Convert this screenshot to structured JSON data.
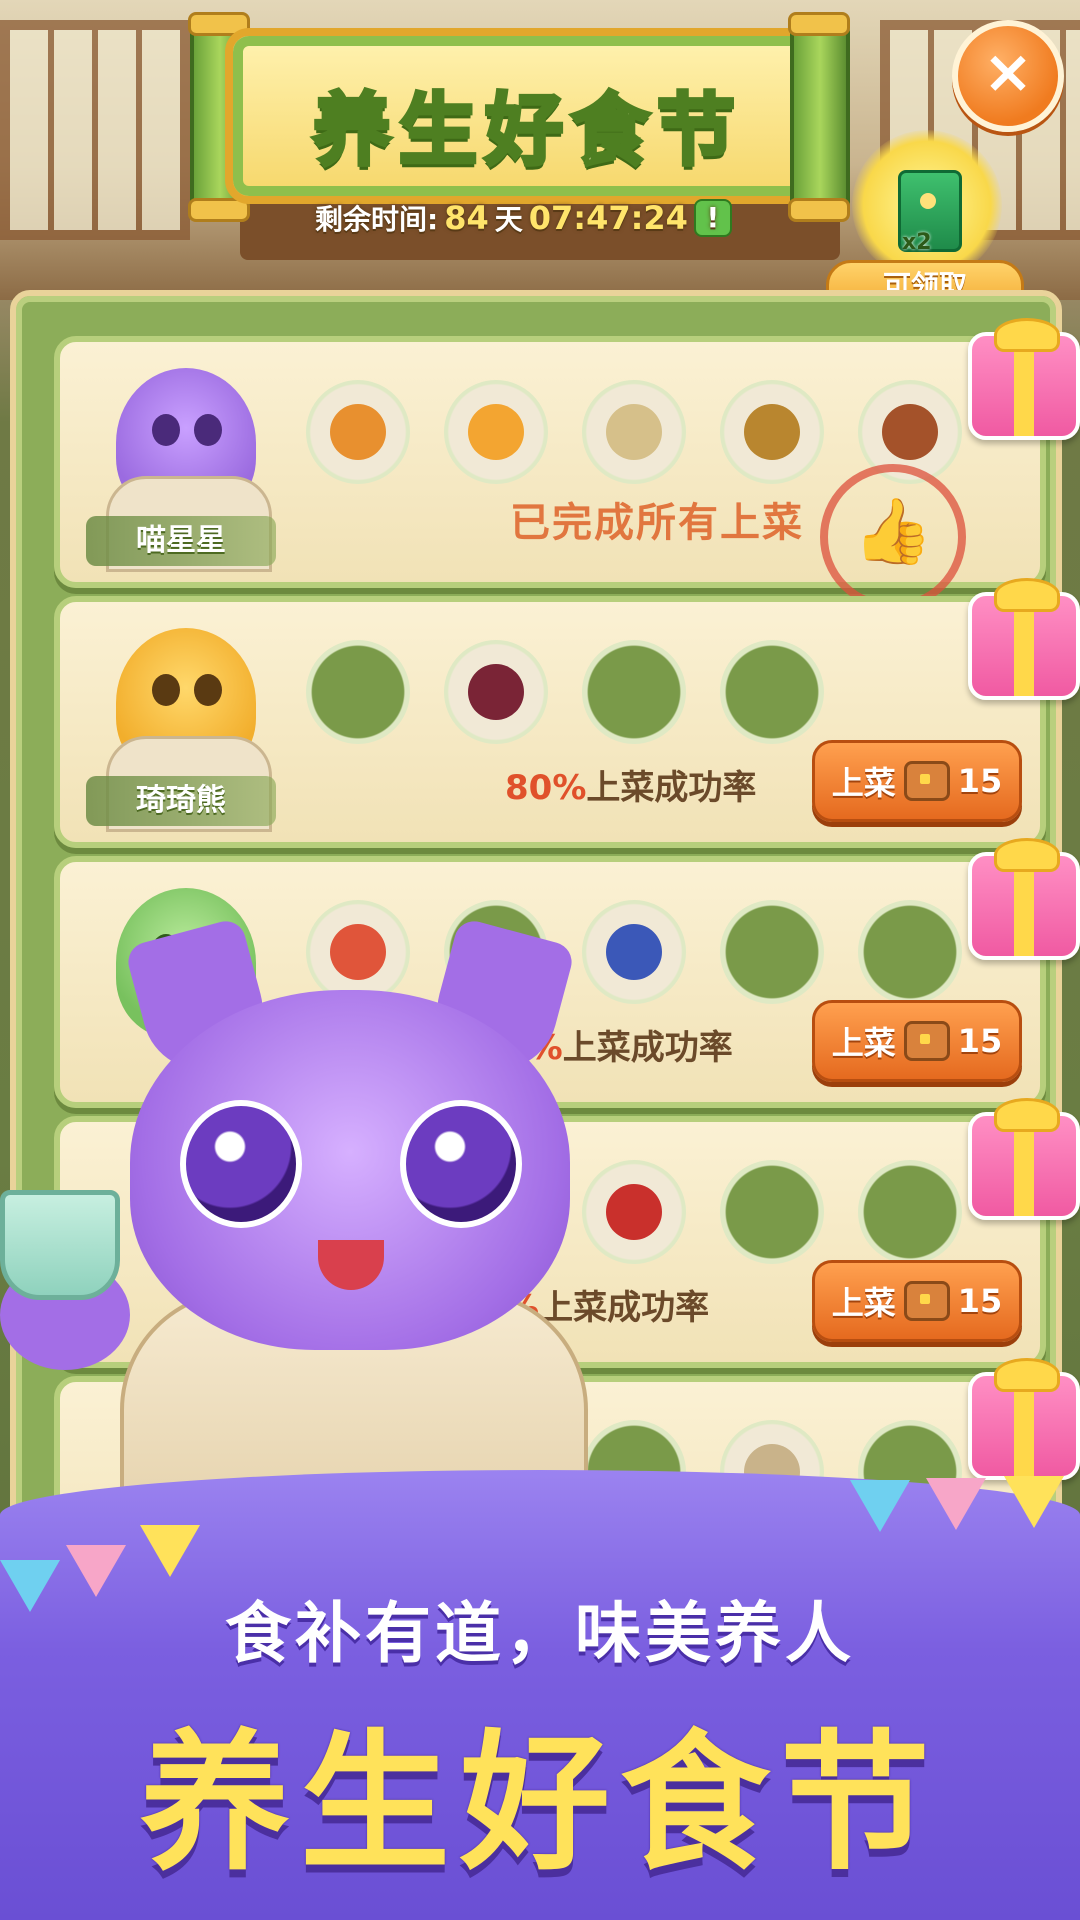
{
  "banner": {
    "title": "养生好食节"
  },
  "timer": {
    "label": "剩余时间:",
    "days": "84",
    "days_unit": "天",
    "clock": "07:47:24",
    "alert_icon": "!"
  },
  "close": {
    "icon": "×"
  },
  "reward": {
    "count": "x2",
    "claim_label": "可领取"
  },
  "rows": [
    {
      "name": "喵星星",
      "avatar": "purple-cat",
      "status": "已完成所有上菜",
      "stamp_icon": "thumbs-up-icon"
    },
    {
      "name": "琦琦熊",
      "avatar": "yellow-bear",
      "rate": "80%",
      "rate_suffix": "上菜成功率",
      "serve_label": "上菜",
      "serve_cost": "15"
    },
    {
      "name": "",
      "avatar": "green-frog",
      "rate": "0%",
      "rate_suffix": "上菜成功率",
      "serve_label": "上菜",
      "serve_cost": "15"
    },
    {
      "name": "",
      "avatar": "hidden",
      "rate": "%",
      "rate_suffix": "上菜成功率",
      "serve_label": "上菜",
      "serve_cost": "15"
    }
  ],
  "footer": {
    "slogan": "食补有道，味美养人",
    "title": "养生好食节"
  },
  "colors": {
    "accent_orange": "#e56a1f",
    "rate_red": "#e0512b",
    "title_yellow": "#ffe25a",
    "footer_purple": "#7b5fe0",
    "panel_green": "#8cad59"
  }
}
